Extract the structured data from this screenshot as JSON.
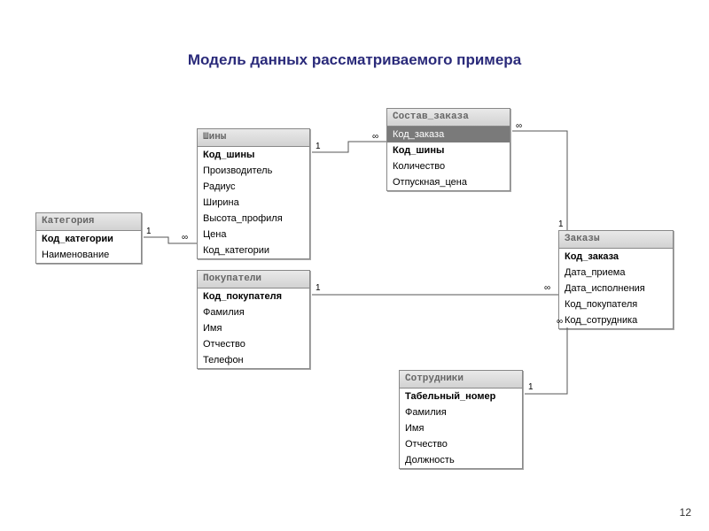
{
  "title": "Модель данных рассматриваемого примера",
  "page_number": "12",
  "entities": {
    "kategoriya": {
      "name": "Категория",
      "fields": [
        {
          "label": "Код_категории",
          "key": true
        },
        {
          "label": "Наименование"
        }
      ]
    },
    "shiny": {
      "name": "Шины",
      "fields": [
        {
          "label": "Код_шины",
          "key": true
        },
        {
          "label": "Производитель"
        },
        {
          "label": "Радиус"
        },
        {
          "label": "Ширина"
        },
        {
          "label": "Высота_профиля"
        },
        {
          "label": "Цена"
        },
        {
          "label": "Код_категории"
        }
      ]
    },
    "sostav": {
      "name": "Состав_заказа",
      "fields": [
        {
          "label": "Код_заказа",
          "selected": true
        },
        {
          "label": "Код_шины",
          "key": true
        },
        {
          "label": "Количество"
        },
        {
          "label": "Отпускная_цена"
        }
      ]
    },
    "pokupateli": {
      "name": "Покупатели",
      "fields": [
        {
          "label": "Код_покупателя",
          "key": true
        },
        {
          "label": "Фамилия"
        },
        {
          "label": "Имя"
        },
        {
          "label": "Отчество"
        },
        {
          "label": "Телефон"
        }
      ]
    },
    "zakazy": {
      "name": "Заказы",
      "fields": [
        {
          "label": "Код_заказа",
          "key": true
        },
        {
          "label": "Дата_приема"
        },
        {
          "label": "Дата_исполнения"
        },
        {
          "label": "Код_покупателя"
        },
        {
          "label": "Код_сотрудника"
        }
      ]
    },
    "sotrudniki": {
      "name": "Сотрудники",
      "fields": [
        {
          "label": "Табельный_номер",
          "key": true
        },
        {
          "label": "Фамилия"
        },
        {
          "label": "Имя"
        },
        {
          "label": "Отчество"
        },
        {
          "label": "Должность"
        }
      ]
    }
  },
  "relationships": [
    {
      "from": "kategoriya",
      "to": "shiny",
      "from_card": "1",
      "to_card": "∞"
    },
    {
      "from": "shiny",
      "to": "sostav",
      "from_card": "1",
      "to_card": "∞"
    },
    {
      "from": "sostav",
      "to": "zakazy",
      "from_card": "∞",
      "to_card": "1"
    },
    {
      "from": "pokupateli",
      "to": "zakazy",
      "from_card": "1",
      "to_card": "∞"
    },
    {
      "from": "sotrudniki",
      "to": "zakazy",
      "from_card": "1",
      "to_card": "∞"
    }
  ],
  "cards": {
    "c1": "1",
    "c2": "∞",
    "c3": "1",
    "c4": "∞",
    "c5": "∞",
    "c6": "1",
    "c7": "1",
    "c8": "∞",
    "c9": "1",
    "c10": "∞"
  }
}
